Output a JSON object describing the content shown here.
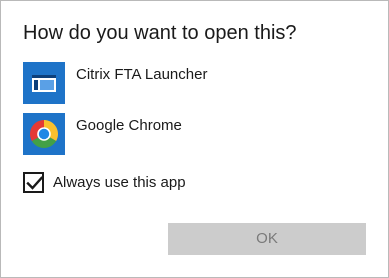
{
  "dialog": {
    "title": "How do you want to open this?",
    "apps": [
      {
        "label": "Citrix FTA Launcher",
        "icon": "citrix-fta-launcher-icon",
        "icon_color": "#1e73c8"
      },
      {
        "label": "Google Chrome",
        "icon": "google-chrome-icon",
        "icon_color": "#1e73c8"
      }
    ],
    "always_use": {
      "label": "Always use this app",
      "checked": true
    },
    "ok_button": {
      "label": "OK",
      "enabled": false
    }
  },
  "colors": {
    "icon_tile": "#1e73c8",
    "button_disabled_bg": "#cccccc",
    "button_disabled_text": "#7a7a7a",
    "border": "#b9b9b9"
  }
}
